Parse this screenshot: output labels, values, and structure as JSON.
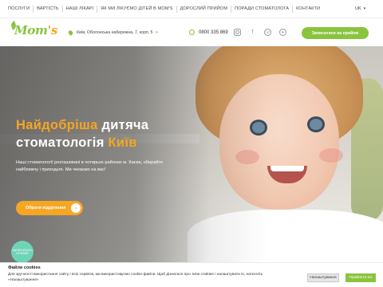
{
  "topnav": {
    "items": [
      "ПОСЛУГИ",
      "ВАРТІСТЬ",
      "НАШІ ЛІКАРІ",
      "ЯК МИ ЛІКУЄМО ДІТЕЙ В MOM'S",
      "ДОРОСЛИЙ ПРИЙОМ",
      "ПОРАДИ СТОМАТОЛОГА",
      "КОНТАКТИ"
    ],
    "lang": "UK"
  },
  "header": {
    "logo_text": "Mom",
    "logo_apos": "'s",
    "address": "Київ, Оболонська набережна, 7, корп. 5",
    "phone": "0800 335 869",
    "socials": [
      "instagram-icon",
      "facebook-icon",
      "viber-icon",
      "telegram-icon"
    ],
    "cta_label": "Записатися на прийом"
  },
  "hero": {
    "title_part1": "Найдобріша ",
    "title_part2": "дитяча",
    "title_part3": "стоматологія ",
    "title_part4": "Київ",
    "subtitle": "Наші стоматології розташовані в чотирьох районах м. Києва, обирайте найближчу і приходьте. Ми чекаємо на вас!",
    "choose_label": "Обрати відділення",
    "choose_arrow": "›"
  },
  "chat": {
    "label": "ЗАПИСАТИСЬ ОНЛАЙН"
  },
  "cookie": {
    "title": "Файли cookies",
    "text": "Для зручності використання сайту і всіх сервісів, ми використовуємо cookie-файли. Щоб дізнатися про типи cookies і налаштувати їх, натисніть «Налаштування»",
    "settings_label": "Налаштування",
    "accept_label": "Прийняти всі"
  },
  "colors": {
    "brand_green": "#8ac43f",
    "accent_orange": "#f5a623"
  }
}
